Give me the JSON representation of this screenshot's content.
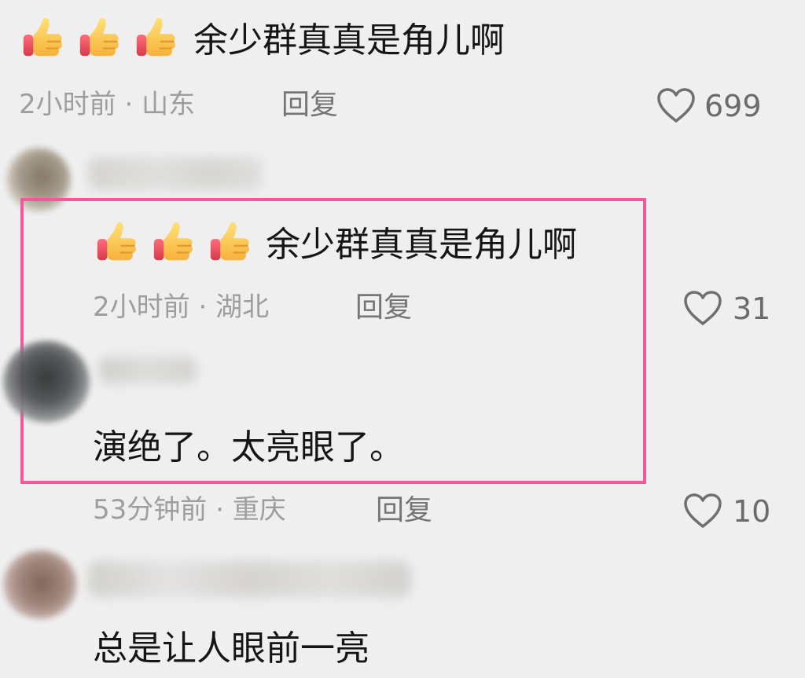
{
  "comments": [
    {
      "text": "余少群真真是角儿啊",
      "time": "2小时前",
      "location": "山东",
      "reply_label": "回复",
      "likes": "699",
      "emoji_name": "thumbs-up-icon"
    },
    {
      "text": "余少群真真是角儿啊",
      "time": "2小时前",
      "location": "湖北",
      "reply_label": "回复",
      "likes": "31",
      "emoji_name": "thumbs-up-icon"
    },
    {
      "text": "演绝了。太亮眼了。",
      "time": "53分钟前",
      "location": "重庆",
      "reply_label": "回复",
      "likes": "10"
    },
    {
      "text": "总是让人眼前一亮"
    }
  ],
  "ui": {
    "meta_separator": "·",
    "highlight_color": "#ee5a9b",
    "meta_color": "#9d9d9d",
    "text_color": "#151515",
    "heart_icon": "heart-outline-icon"
  }
}
